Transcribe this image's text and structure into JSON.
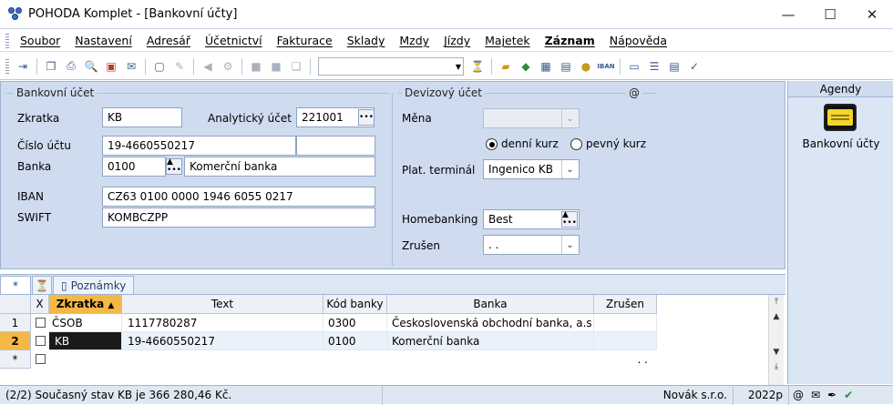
{
  "window": {
    "title": "POHODA Komplet - [Bankovní účty]"
  },
  "menu": [
    "Soubor",
    "Nastavení",
    "Adresář",
    "Účetnictví",
    "Fakturace",
    "Sklady",
    "Mzdy",
    "Jízdy",
    "Majetek",
    "Záznam",
    "Nápověda"
  ],
  "bank_account": {
    "group_title": "Bankovní účet",
    "zkratka_label": "Zkratka",
    "zkratka": "KB",
    "analyticky_label": "Analytický účet",
    "analyticky": "221001",
    "cislo_label": "Číslo účtu",
    "cislo": "19-4660550217",
    "banka_label": "Banka",
    "banka_kod": "0100",
    "banka_nazev": "Komerční banka",
    "iban_label": "IBAN",
    "iban": "CZ63 0100 0000 1946 6055 0217",
    "swift_label": "SWIFT",
    "swift": "KOMBCZPP"
  },
  "currency": {
    "group_title": "Devizový účet",
    "at_sign": "@",
    "mena_label": "Měna",
    "mena": "",
    "denni_kurz": "denní kurz",
    "pevny_kurz": "pevný kurz",
    "terminal_label": "Plat. terminál",
    "terminal": "Ingenico KB",
    "homebanking_label": "Homebanking",
    "homebanking": "Best",
    "zruseno_label": "Zrušen",
    "zruseno": ". ."
  },
  "agenda": {
    "title": "Agendy",
    "item": "Bankovní účty"
  },
  "tabs": {
    "star": "*",
    "poznamky": "Poznámky"
  },
  "grid": {
    "headers": [
      "X",
      "Zkratka",
      "Text",
      "Kód banky",
      "Banka",
      "Zrušen"
    ],
    "rows": [
      {
        "num": "1",
        "zkratka": "ČSOB",
        "text": "1117780287",
        "kod": "0300",
        "banka": "Československá obchodní banka, a.s.",
        "zrusen": ""
      },
      {
        "num": "2",
        "zkratka": "KB",
        "text": "19-4660550217",
        "kod": "0100",
        "banka": "Komerční banka",
        "zrusen": ""
      },
      {
        "num": "*",
        "zkratka": "",
        "text": "",
        "kod": "",
        "banka": "",
        "zrusen": ". ."
      }
    ]
  },
  "status": {
    "message": "(2/2) Současný stav KB je 366 280,46 Kč.",
    "company": "Novák s.r.o.",
    "year": "2022p",
    "at": "@"
  }
}
